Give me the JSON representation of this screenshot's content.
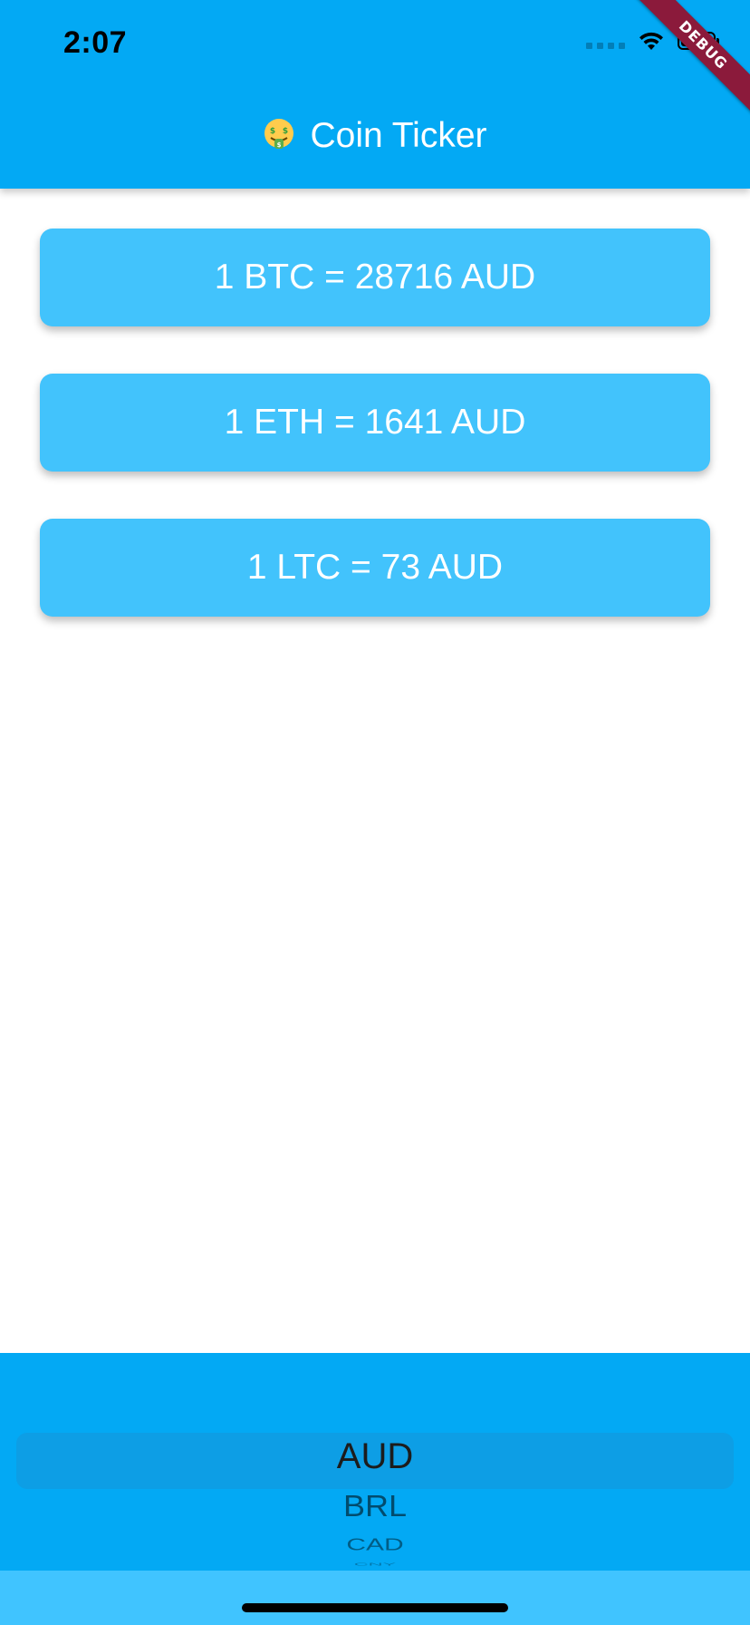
{
  "status_bar": {
    "time": "2:07"
  },
  "app_bar": {
    "title": "Coin Ticker",
    "title_icon": "money-mouth-face-emoji",
    "color": "#03A9F4"
  },
  "debug_banner": {
    "label": "DEBUG"
  },
  "rates": [
    {
      "text": "1 BTC = 28716 AUD"
    },
    {
      "text": "1 ETH = 1641 AUD"
    },
    {
      "text": "1 LTC = 73 AUD"
    }
  ],
  "card_color": "#42C3FC",
  "currency_picker": {
    "selected": "AUD",
    "options_below": [
      "BRL",
      "CAD",
      "CNY"
    ]
  },
  "home_bar_color": "#40C4FF"
}
